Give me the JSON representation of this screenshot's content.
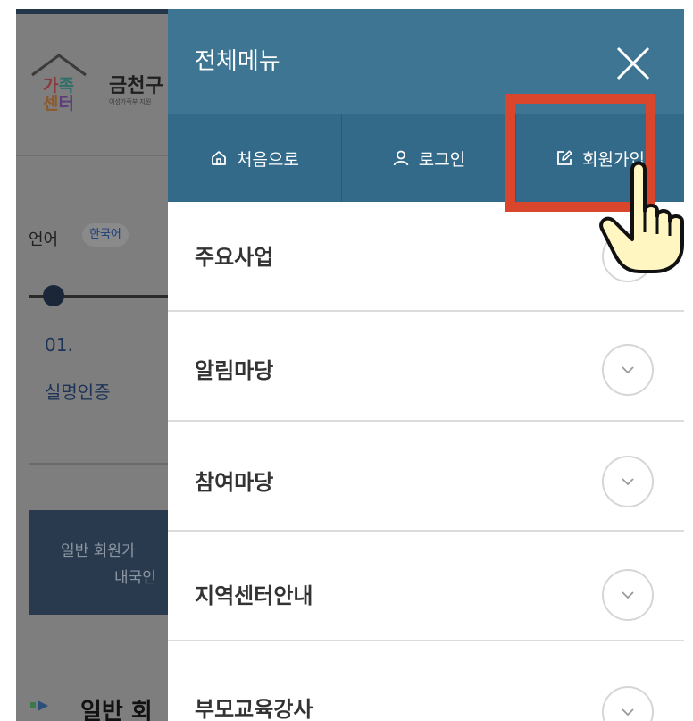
{
  "background_page": {
    "logo_text_line1": [
      "가",
      "족"
    ],
    "logo_text_line2": [
      "센",
      "터"
    ],
    "center_name": "금천구",
    "center_sub": "여성가족부 지원",
    "language_label": "언어",
    "language_value": "한국어",
    "step_number": "01.",
    "step_title": "실명인증",
    "info_line1": "일반 회원가",
    "info_line2": "내국인",
    "bottom_title": "일반 회"
  },
  "menu": {
    "title": "전체메뉴",
    "close_icon": "close-icon",
    "quick_links": [
      {
        "label": "처음으로",
        "icon": "home-icon"
      },
      {
        "label": "로그인",
        "icon": "user-icon"
      },
      {
        "label": "회원가입",
        "icon": "edit-icon"
      }
    ],
    "items": [
      {
        "label": "주요사업"
      },
      {
        "label": "알림마당"
      },
      {
        "label": "참여마당"
      },
      {
        "label": "지역센터안내"
      },
      {
        "label": "부모교육강사"
      }
    ]
  },
  "colors": {
    "menu_header": "#3e7593",
    "quick_bar": "#346a89",
    "highlight": "#d9462b",
    "overlay": "#7e7e7e"
  },
  "annotation": {
    "pointer_icon": "hand-pointer-icon"
  }
}
